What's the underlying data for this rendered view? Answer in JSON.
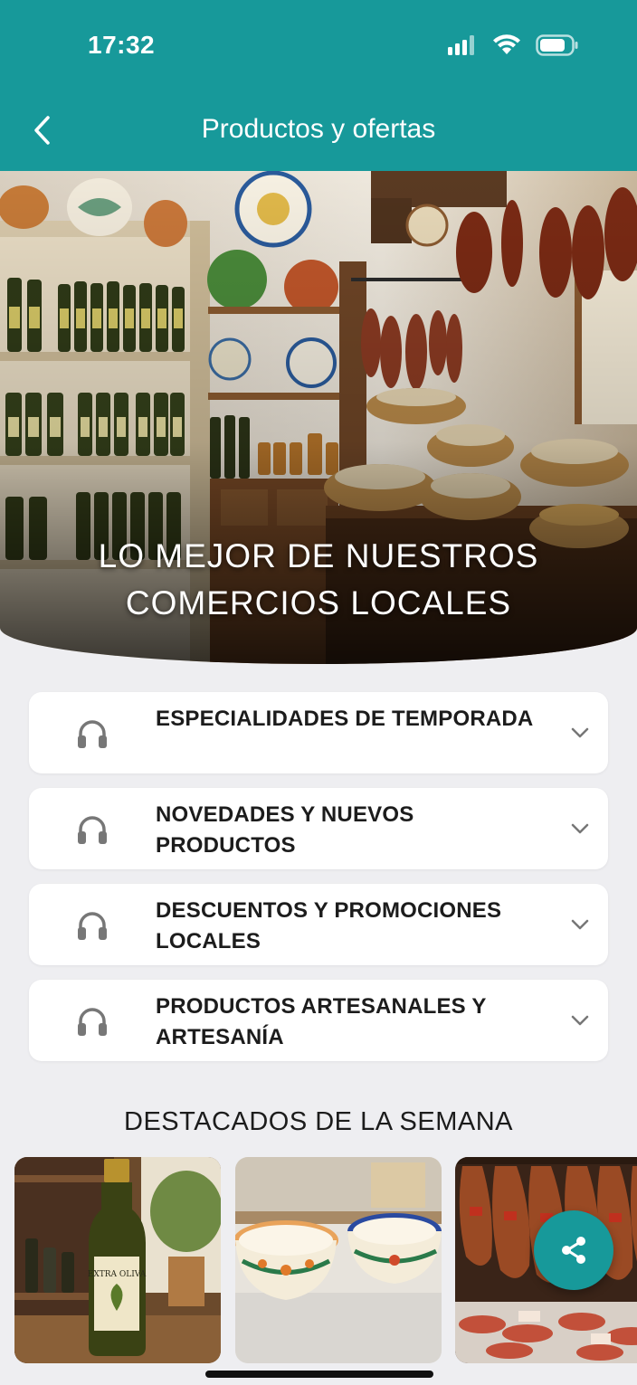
{
  "status_bar": {
    "time": "17:32"
  },
  "nav": {
    "title": "Productos y ofertas"
  },
  "hero": {
    "title_line1": "LO MEJOR DE NUESTROS",
    "title_line2": "COMERCIOS LOCALES"
  },
  "categories": [
    {
      "label": "ESPECIALIDADES DE TEMPORADA",
      "icon": "headphones-icon"
    },
    {
      "label": "NOVEDADES Y NUEVOS PRODUCTOS",
      "icon": "headphones-icon"
    },
    {
      "label": "DESCUENTOS Y PROMOCIONES LOCALES",
      "icon": "headphones-icon"
    },
    {
      "label": "PRODUCTOS ARTESANALES Y ARTESANÍA",
      "icon": "headphones-icon"
    }
  ],
  "featured": {
    "title": "DESTACADOS DE LA SEMANA",
    "items": [
      {
        "image": "olive-oil-bottle",
        "label_on_bottle": "EXTRA OLIVA"
      },
      {
        "image": "ceramic-bowls"
      },
      {
        "image": "cured-hams"
      }
    ]
  },
  "colors": {
    "brand": "#17999a",
    "background": "#eeeef1",
    "card": "#ffffff",
    "text": "#1c1c1c"
  },
  "icons": {
    "back": "chevron-left-icon",
    "expand": "chevron-down-icon",
    "share": "share-icon"
  }
}
